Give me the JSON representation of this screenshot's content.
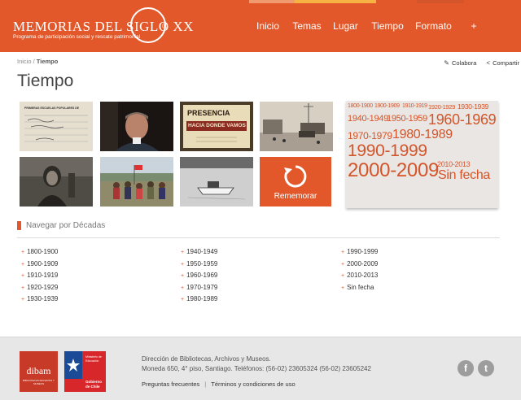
{
  "header": {
    "logo_title": "MEMORIAS DEL SIGLO XX",
    "logo_subtitle": "Programa de participación social y rescate patrimonial",
    "logo_mark": "®",
    "bg_color": "#e2582a",
    "stripe_colors": [
      "#f19a6f",
      "#f6b343",
      "#f6b343",
      "#e2582a",
      "#d4552a"
    ]
  },
  "nav": {
    "items": [
      {
        "label": "Inicio"
      },
      {
        "label": "Temas"
      },
      {
        "label": "Lugar"
      },
      {
        "label": "Tiempo"
      },
      {
        "label": "Formato"
      },
      {
        "label": "+"
      }
    ]
  },
  "breadcrumb": {
    "home": "Inicio",
    "separator": "/",
    "current": "Tiempo"
  },
  "actions": {
    "colabora": "Colabora",
    "compartir": "Compartir"
  },
  "page_title": "Tiempo",
  "remember_button": {
    "label": "Rememorar",
    "icon": "refresh-icon"
  },
  "cloud": {
    "items": [
      {
        "label": "1800-1900"
      },
      {
        "label": "1900-1909"
      },
      {
        "label": "1910-1919"
      },
      {
        "label": "1920-1929"
      },
      {
        "label": "1930-1939"
      },
      {
        "label": "1940-1949"
      },
      {
        "label": "1950-1959"
      },
      {
        "label": "1960-1969"
      },
      {
        "label": "1970-1979"
      },
      {
        "label": "1980-1989"
      },
      {
        "label": "1990-1999"
      },
      {
        "label": "2000-2009"
      },
      {
        "label": "2010-2013"
      },
      {
        "label": "Sin fecha"
      }
    ]
  },
  "decades_section": {
    "title": "Navegar por Décadas",
    "columns": [
      [
        "1800-1900",
        "1900-1909",
        "1910-1919",
        "1920-1929",
        "1930-1939"
      ],
      [
        "1940-1949",
        "1950-1959",
        "1960-1969",
        "1970-1979",
        "1980-1989"
      ],
      [
        "1990-1999",
        "2000-2009",
        "2010-2013",
        "Sin fecha"
      ]
    ]
  },
  "thumbnails": {
    "doc1_heading": "PRIMERAS ESCUELAS POPULARES DE",
    "presencia_line1": "PRESENCIA",
    "presencia_line2": "HACIA DONDE VAMOS"
  },
  "footer": {
    "dibam_word": "dibam",
    "dibam_sub": "BIBLIOTECAS ARCHIVOS Y MUSEOS",
    "gob_ministry": "Ministerio de Educación",
    "gob_name": "Gobierno de Chile",
    "address_line1": "Dirección de Bibliotecas, Archivos y Museos.",
    "address_line2": "Moneda 650, 4° piso, Santiago. Teléfonos: (56-02) 23605324 (56-02) 23605242",
    "link_faq": "Preguntas frecuentes",
    "link_separator": "|",
    "link_terms": "Términos y condiciones de uso",
    "facebook_glyph": "f",
    "twitter_glyph": "t"
  }
}
